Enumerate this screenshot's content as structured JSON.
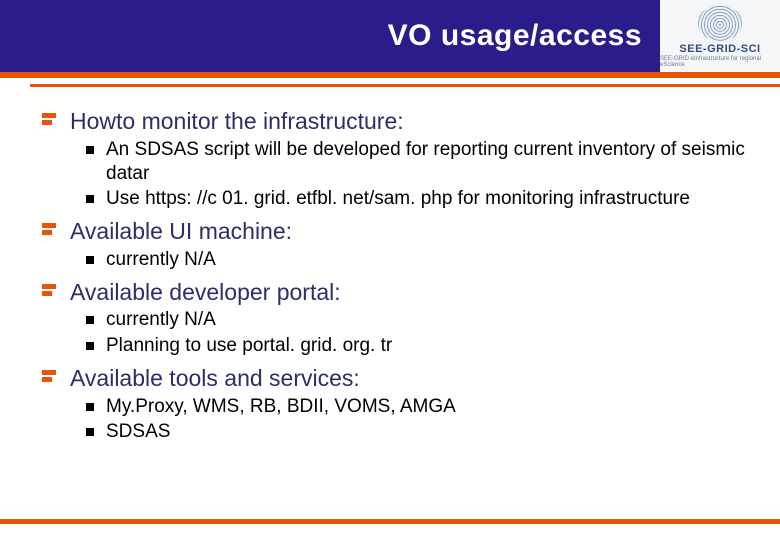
{
  "header": {
    "title": "VO usage/access",
    "logo": {
      "main": "SEE-GRID-SCI",
      "sub": "SEE-GRID eInfrastructure for regional eScience"
    }
  },
  "sections": [
    {
      "heading": "Howto monitor the infrastructure:",
      "items": [
        "An SDSAS script will be developed for reporting current inventory of seismic datar",
        "Use https: //c 01. grid. etfbl. net/sam. php  for monitoring infrastructure"
      ]
    },
    {
      "heading": "Available UI machine:",
      "items": [
        "currently N/A"
      ]
    },
    {
      "heading": "Available developer portal:",
      "items": [
        "currently N/A",
        "Planning to use portal. grid. org. tr"
      ]
    },
    {
      "heading": "Available tools and services:",
      "items": [
        "My.Proxy, WMS, RB, BDII, VOMS, AMGA",
        "SDSAS"
      ]
    }
  ]
}
